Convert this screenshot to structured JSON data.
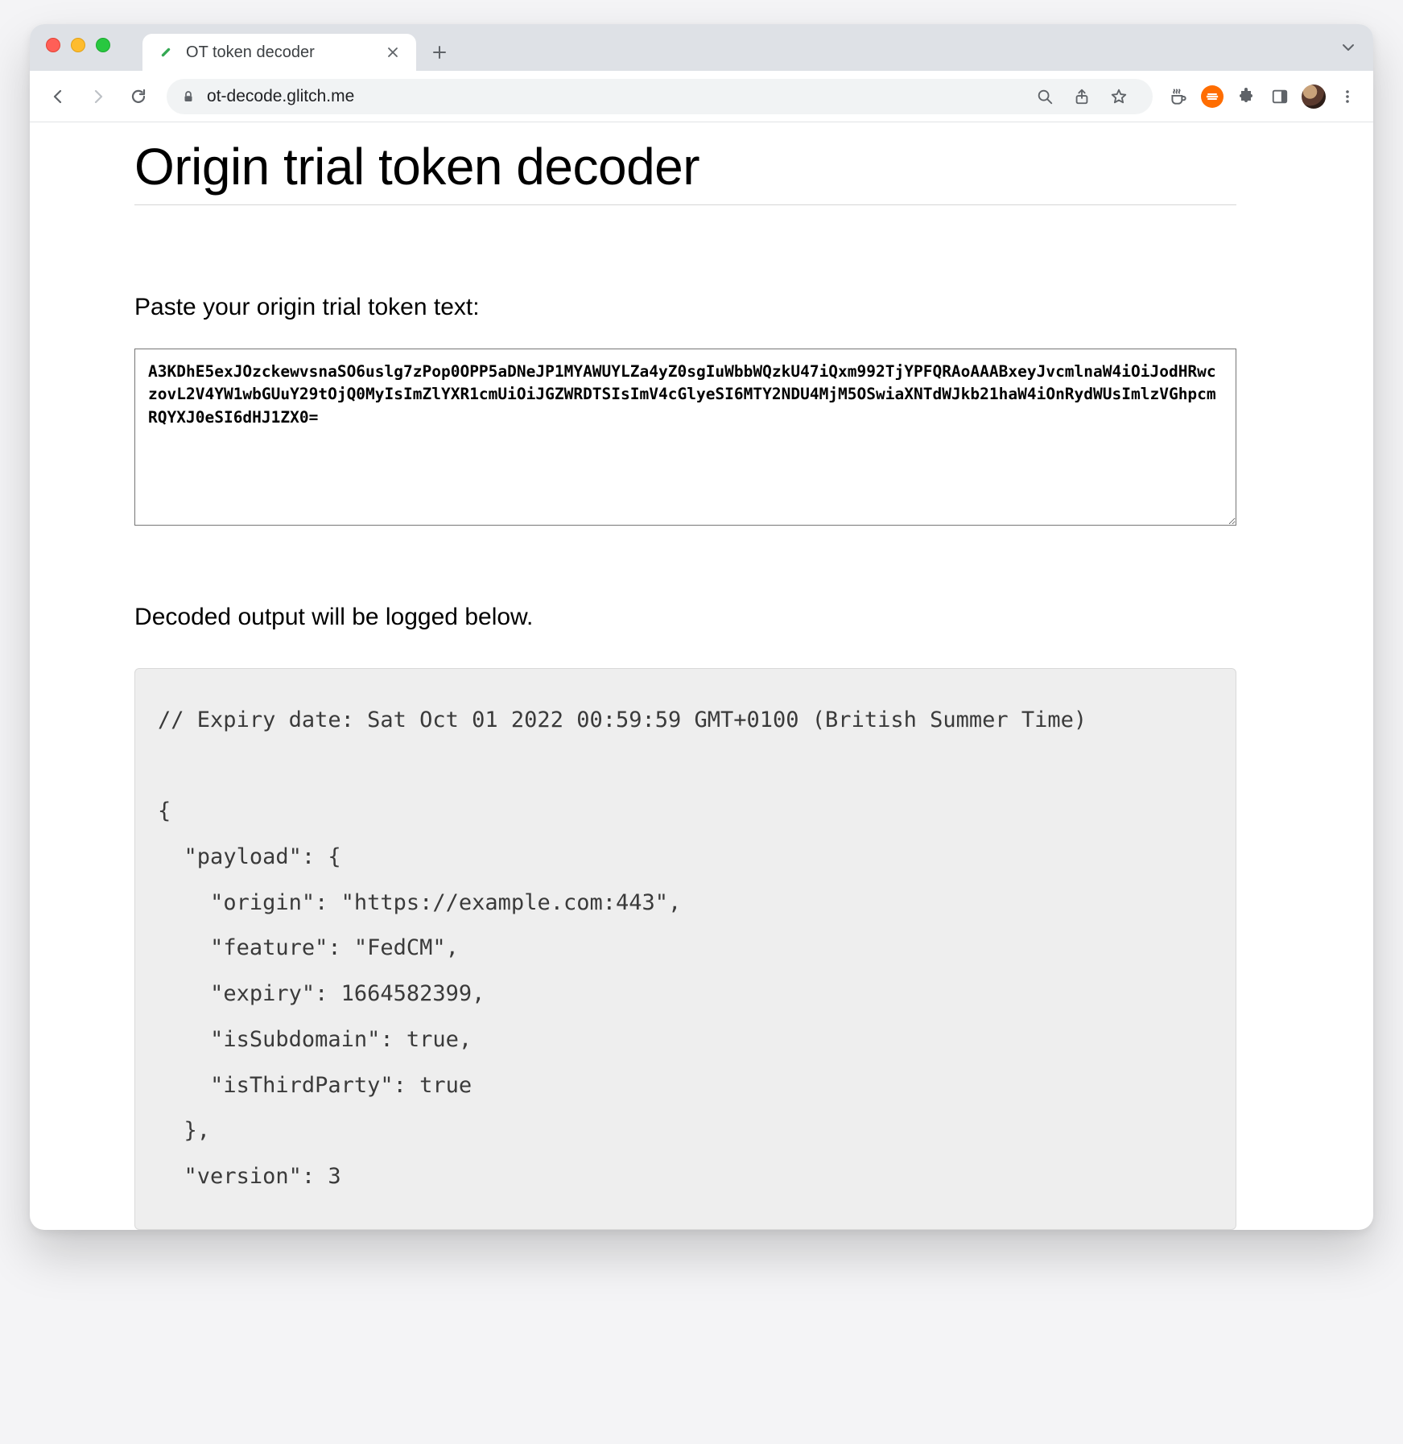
{
  "window": {
    "tab_title": "OT token decoder",
    "favicon_name": "token-icon"
  },
  "toolbar": {
    "url": "ot-decode.glitch.me"
  },
  "page": {
    "title": "Origin trial token decoder",
    "paste_label": "Paste your origin trial token text:",
    "token_value": "A3KDhE5exJOzckewvsnaSO6uslg7zPop0OPP5aDNeJP1MYAWUYLZa4yZ0sgIuWbbWQzkU47iQxm992TjYPFQRAoAAABxeyJvcmlnaW4iOiJodHRwczovL2V4YW1wbGUuY29tOjQ0MyIsImZlYXR1cmUiOiJGZWRDTSIsImV4cGlyeSI6MTY2NDU4MjM5OSwiaXNTdWJkb21haW4iOnRydWUsImlzVGhpcmRQYXJ0eSI6dHJ1ZX0=",
    "decoded_label": "Decoded output will be logged below.",
    "decoded_output": "// Expiry date: Sat Oct 01 2022 00:59:59 GMT+0100 (British Summer Time)\n\n{\n  \"payload\": {\n    \"origin\": \"https://example.com:443\",\n    \"feature\": \"FedCM\",\n    \"expiry\": 1664582399,\n    \"isSubdomain\": true,\n    \"isThirdParty\": true\n  },\n  \"version\": 3"
  }
}
